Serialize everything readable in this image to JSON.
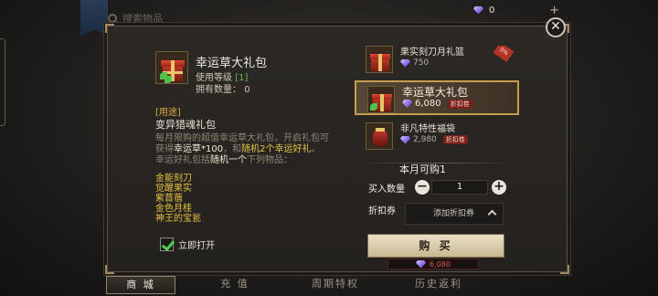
{
  "top": {
    "search_placeholder": "搜索物品",
    "currency_value": "0",
    "currency_add": "+"
  },
  "close_label": "✕",
  "detail": {
    "name": "幸运草大礼包",
    "level_label": "使用等级",
    "level_value": "[1]",
    "own_label": "拥有数量：",
    "own_value": "0",
    "usage_tag": "[用途]",
    "usage_title": "变异猎魂礼包",
    "desc_1": "每月限购的超值幸运草大礼包，开启礼包可获得",
    "desc_2": "幸运草*100",
    "desc_3": "，和",
    "desc_4": "随机2个幸运好礼",
    "desc_5": "。",
    "desc_6": "幸运好礼包括",
    "desc_7": "随机一个",
    "desc_8": "下列物品：",
    "rewards": [
      "金能刻刀",
      "觉醒果实",
      "紫苜蓿",
      "金色月桂",
      "神王的宝瓮"
    ],
    "auto_open_label": "立即打开"
  },
  "shop": {
    "items": [
      {
        "name": "果实刻刀月礼篮",
        "price": "750",
        "discount": "",
        "ribbon": "0%"
      },
      {
        "name": "幸运草大礼包",
        "price": "6,080",
        "discount": "折扣卷"
      },
      {
        "name": "非凡特性福袋",
        "price": "2,980",
        "discount": "折扣卷"
      }
    ],
    "month_limit": "本月可购1",
    "qty_label": "买入数量",
    "qty_minus": "−",
    "qty_value": "1",
    "qty_plus": "+",
    "coupon_label": "折扣券",
    "coupon_placeholder": "添加折扣券",
    "buy_label": "购 买",
    "buy_price": "6,080"
  },
  "nav": {
    "tabs": [
      "商 城",
      "充 值",
      "周期特权",
      "历史返利"
    ],
    "active_index": 0
  },
  "colors": {
    "accent_gold": "#c79c4e",
    "level_green": "#5fc04e",
    "highlight_yellow": "#e6c040",
    "price_red": "#e05a4a"
  }
}
